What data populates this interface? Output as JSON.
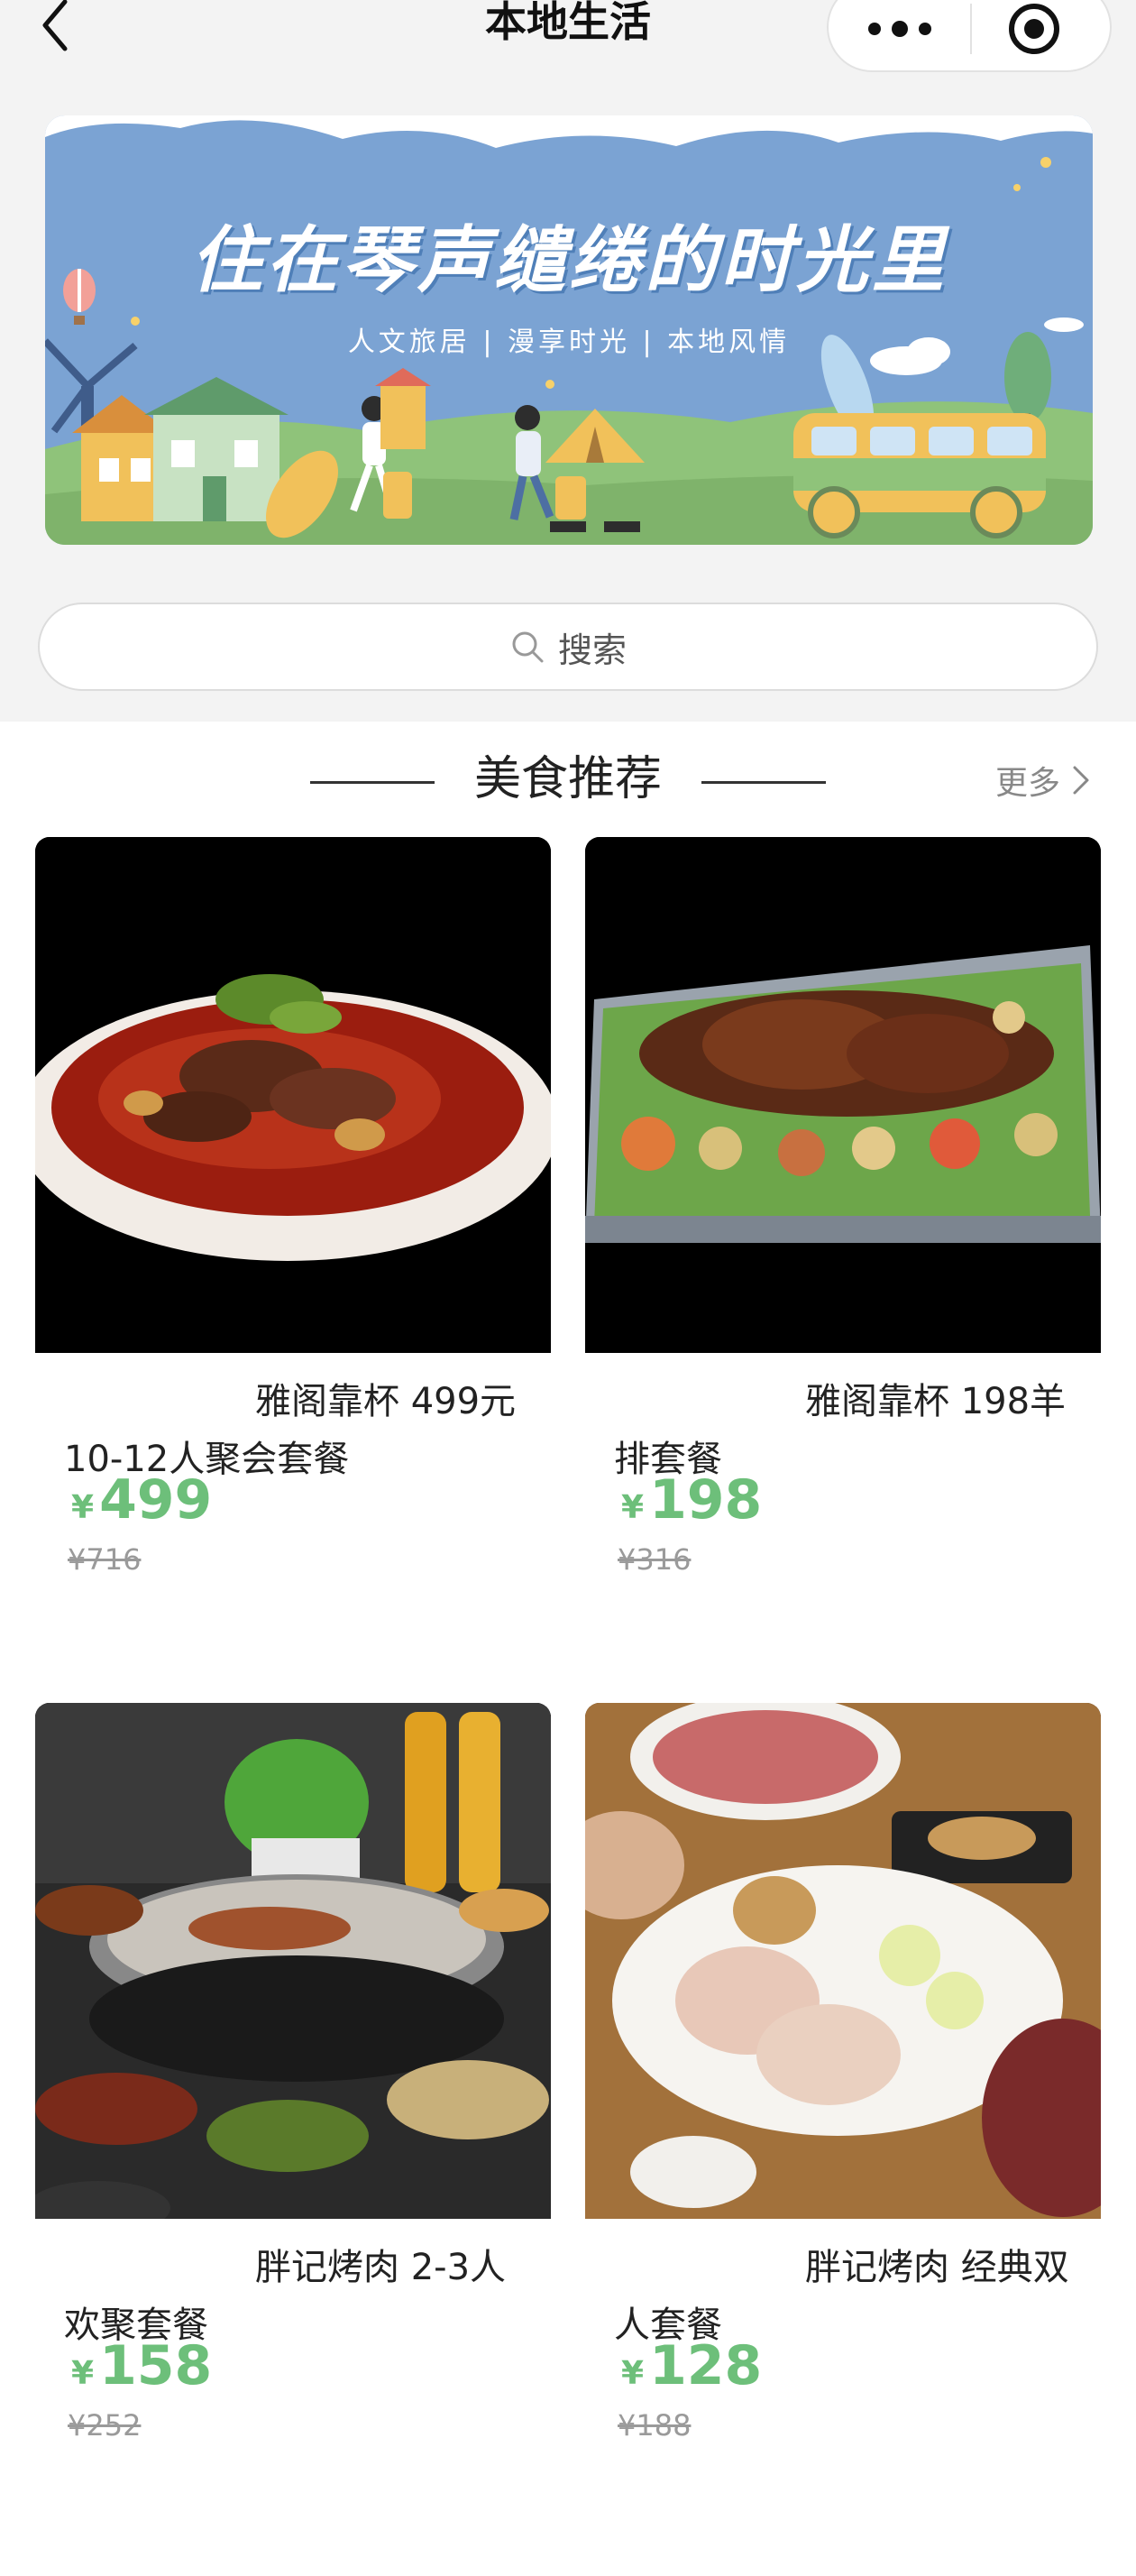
{
  "nav": {
    "title": "本地生活"
  },
  "banner": {
    "title": "住在琴声缱绻的时光里",
    "subtitle": "人文旅居 | 漫享时光 | 本地风情"
  },
  "search": {
    "placeholder": "搜索"
  },
  "section": {
    "title": "美食推荐",
    "more_label": "更多"
  },
  "products": [
    {
      "title": "雅阁靠杯 499元10-12人聚会套餐",
      "currency": "¥",
      "price": "499",
      "original_price": "¥716"
    },
    {
      "title": "雅阁靠杯 198羊排套餐",
      "currency": "¥",
      "price": "198",
      "original_price": "¥316"
    },
    {
      "title": "胖记烤肉 2-3人欢聚套餐",
      "currency": "¥",
      "price": "158",
      "original_price": "¥252"
    },
    {
      "title": "胖记烤肉 经典双人套餐",
      "currency": "¥",
      "price": "128",
      "original_price": "¥188"
    }
  ],
  "colors": {
    "price_green": "#6dbf7a",
    "banner_sky": "#7ba3d3",
    "banner_grass": "#8fc37a"
  }
}
